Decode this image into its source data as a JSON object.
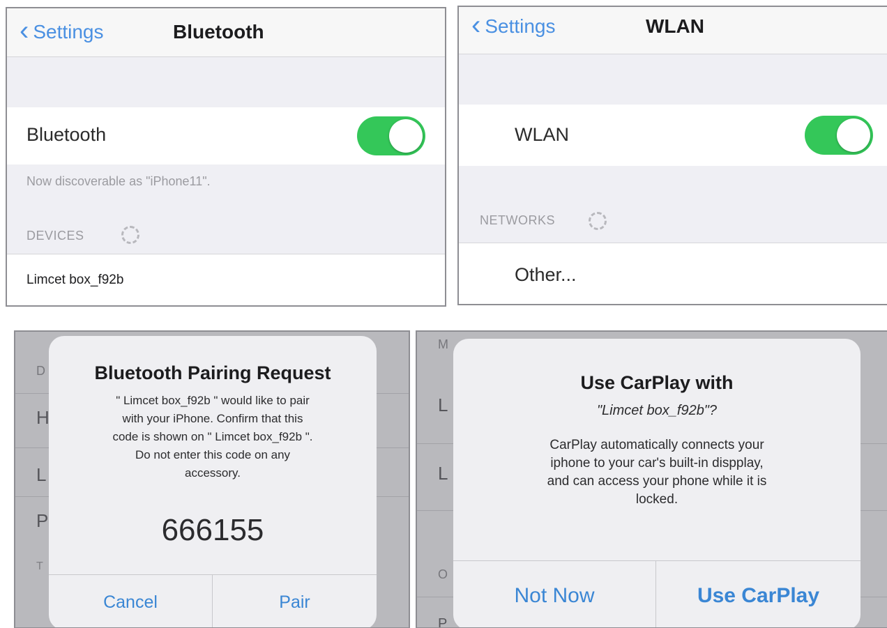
{
  "bluetooth_screen": {
    "back_label": "Settings",
    "title": "Bluetooth",
    "toggle_label": "Bluetooth",
    "toggle_on": true,
    "discoverable_text": "Now discoverable as \"iPhone11\".",
    "devices_header": "DEVICES",
    "device_name": "Limcet box_f92b"
  },
  "wlan_screen": {
    "back_label": "Settings",
    "title": "WLAN",
    "toggle_label": "WLAN",
    "toggle_on": true,
    "networks_header": "NETWORKS",
    "other_label": "Other..."
  },
  "pairing_alert": {
    "title": "Bluetooth Pairing Request",
    "message_line1": "\" Limcet box_f92b \" would like to pair",
    "message_line2": "with your iPhone. Confirm that this",
    "message_line3": "code is shown on \" Limcet box_f92b \".",
    "message_line4": "Do not enter this code on any",
    "message_line5": "accessory.",
    "code": "666155",
    "cancel_label": "Cancel",
    "pair_label": "Pair",
    "background_letters": [
      "D",
      "H",
      "L",
      "P",
      "T"
    ]
  },
  "carplay_alert": {
    "title": "Use CarPlay with",
    "device_line": "\"Limcet box_f92b\"?",
    "message_line1": "CarPlay automatically connects your",
    "message_line2": "iphone to your car's built-in dispplay,",
    "message_line3": "and can access your phone while it is",
    "message_line4": "locked.",
    "not_now_label": "Not Now",
    "use_label": "Use CarPlay",
    "background_letters": [
      "M",
      "L",
      "L",
      "O",
      "P"
    ]
  },
  "colors": {
    "accent": "#4a90e2",
    "toggle_on": "#34c759",
    "grouped_background": "#efeff4",
    "dim_background": "#b9b9bd"
  }
}
